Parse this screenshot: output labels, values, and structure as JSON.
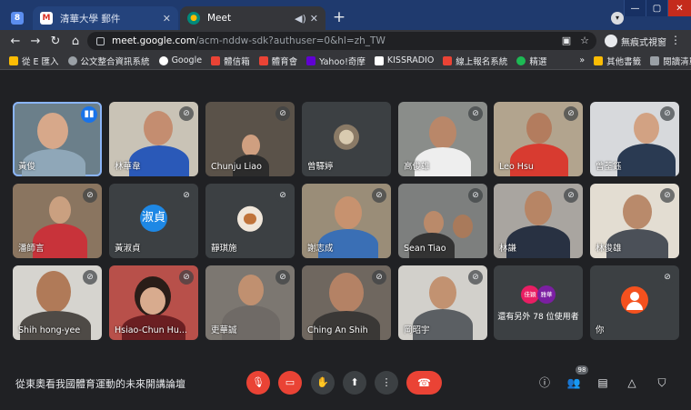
{
  "browser": {
    "tabs": [
      {
        "label": "",
        "favicon_letter": "8"
      },
      {
        "label": "清華大學 郵件",
        "favicon_letter": "M"
      },
      {
        "label": "Meet",
        "favicon_letter": "●"
      }
    ],
    "url_host": "meet.google.com",
    "url_path": "/acm-nddw-sdk?authuser=0&hl=zh_TW",
    "incognito_label": "無痕式視窗"
  },
  "bookmarks": [
    "從 E 匯入",
    "公文整合資訊系統",
    "Google",
    "體信箱",
    "體育會",
    "Yahoo!奇摩",
    "KISSRADIO",
    "線上報名系統",
    "精選",
    "»",
    "其他書籤",
    "閱讀清單"
  ],
  "participants": [
    {
      "name": "黃俊",
      "type": "video"
    },
    {
      "name": "林華韋",
      "type": "video"
    },
    {
      "name": "Chunju Liao",
      "type": "video"
    },
    {
      "name": "曾驛婷",
      "type": "photo"
    },
    {
      "name": "高俊雄",
      "type": "video"
    },
    {
      "name": "Leo Hsu",
      "type": "video"
    },
    {
      "name": "曾荃鈺",
      "type": "video"
    },
    {
      "name": "潘師言",
      "type": "video"
    },
    {
      "name": "黃淑貞",
      "type": "letter",
      "letter": "淑貞"
    },
    {
      "name": "靜琪施",
      "type": "photo"
    },
    {
      "name": "謝志成",
      "type": "video"
    },
    {
      "name": "Sean Tiao",
      "type": "video"
    },
    {
      "name": "林謙",
      "type": "video"
    },
    {
      "name": "林俊雄",
      "type": "video"
    },
    {
      "name": "Shih hong-yee",
      "type": "video"
    },
    {
      "name": "Hsiao-Chun Hu...",
      "type": "video"
    },
    {
      "name": "吏華誠",
      "type": "video"
    },
    {
      "name": "Ching An Shih",
      "type": "video"
    },
    {
      "name": "岡昭宇",
      "type": "video"
    },
    {
      "name": "還有另外 78 位使用者",
      "type": "others",
      "avatars": [
        "佳穎",
        "雅華"
      ]
    },
    {
      "name": "你",
      "type": "self"
    }
  ],
  "meeting": {
    "title": "從東奧看我國體育運動的未來開講論壇",
    "participant_count": "98"
  },
  "colors": {
    "end_call": "#ea4335",
    "active_speaker": "#8ab4f8",
    "letter_avatar": "#1e88e5",
    "self_avatar": "#f4511e"
  }
}
